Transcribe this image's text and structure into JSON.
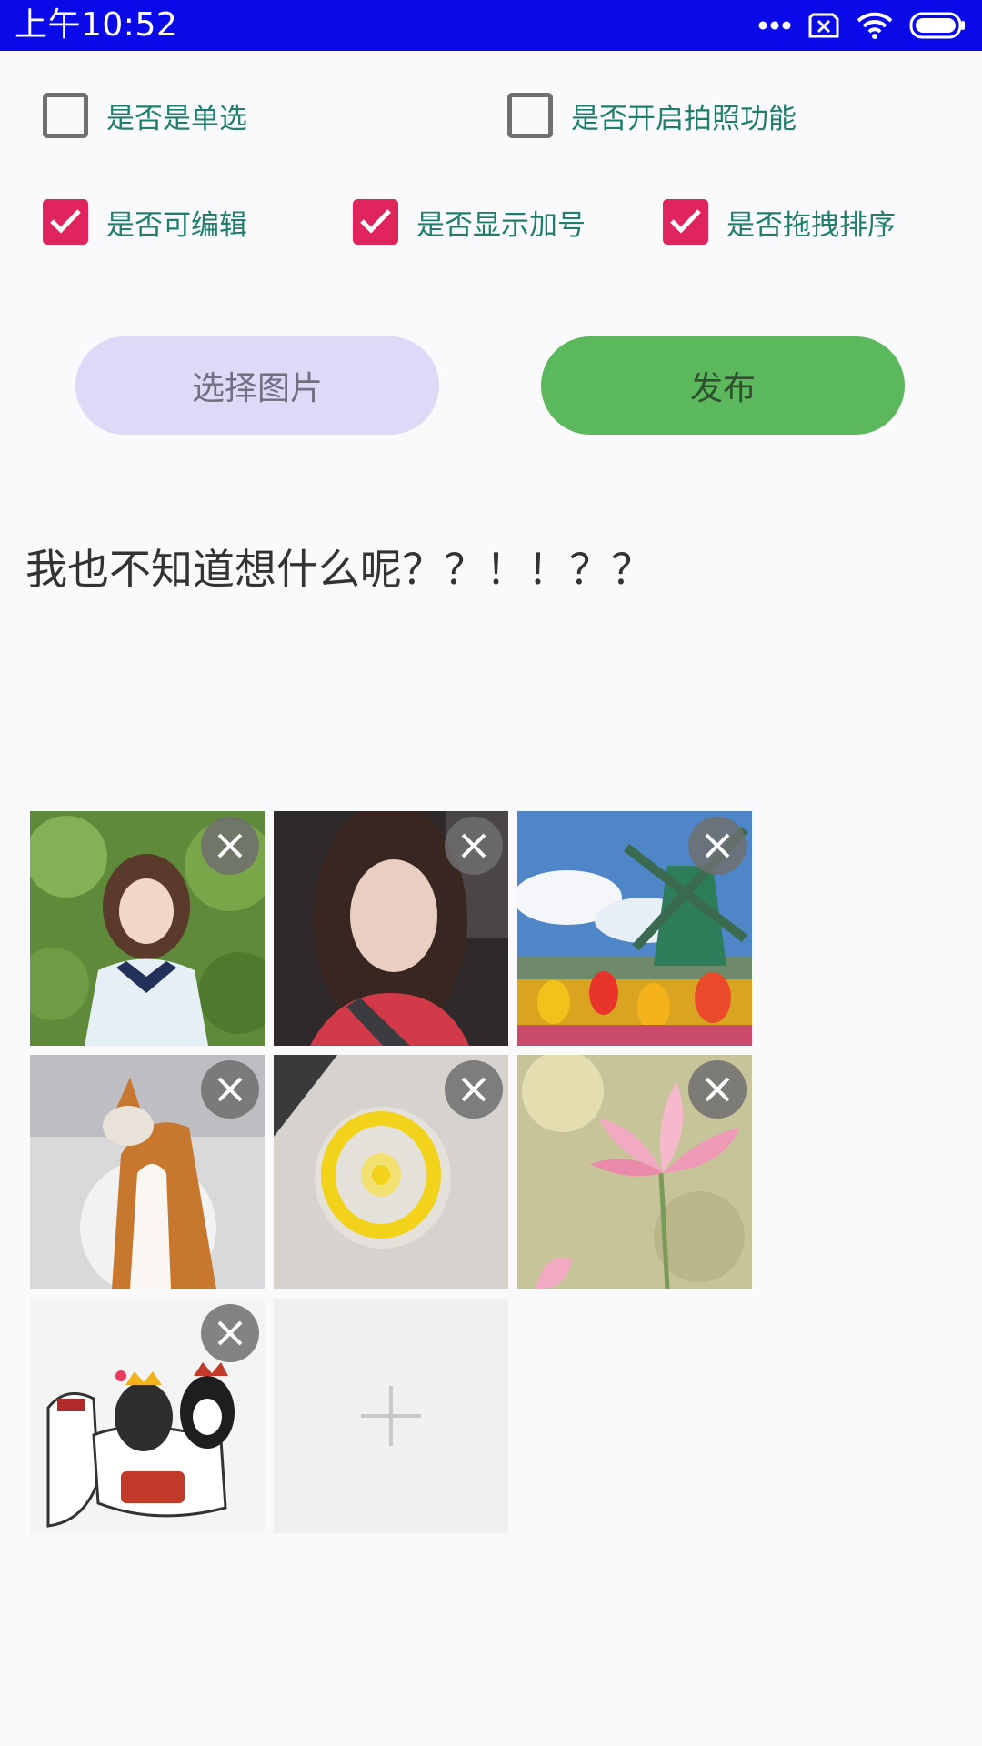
{
  "status_bar": {
    "time": "上午10:52",
    "icons": [
      "more-dots-icon",
      "sim-x-icon",
      "wifi-icon",
      "battery-icon"
    ]
  },
  "options": {
    "single_select": {
      "label": "是否是单选",
      "checked": false
    },
    "camera": {
      "label": "是否开启拍照功能",
      "checked": false
    },
    "editable": {
      "label": "是否可编辑",
      "checked": true
    },
    "show_plus": {
      "label": "是否显示加号",
      "checked": true
    },
    "drag_sort": {
      "label": "是否拖拽排序",
      "checked": true
    }
  },
  "buttons": {
    "select_images": "选择图片",
    "publish": "发布"
  },
  "content": {
    "text": "我也不知道想什么呢？？！！？？"
  },
  "images": [
    {
      "name": "girl-sailor-photo"
    },
    {
      "name": "girl-car-photo"
    },
    {
      "name": "windmill-tulips-photo"
    },
    {
      "name": "corgi-snow-photo"
    },
    {
      "name": "yellow-fidget-spinner-photo"
    },
    {
      "name": "pink-lotus-photo"
    },
    {
      "name": "cartoon-dogs-horse-photo"
    }
  ],
  "colors": {
    "status_bar": "#0A0AE8",
    "checkbox_checked": "#E0245E",
    "label_teal": "#1F7F6C",
    "select_button": "#DCDAF7",
    "publish_button": "#5CB85C"
  }
}
